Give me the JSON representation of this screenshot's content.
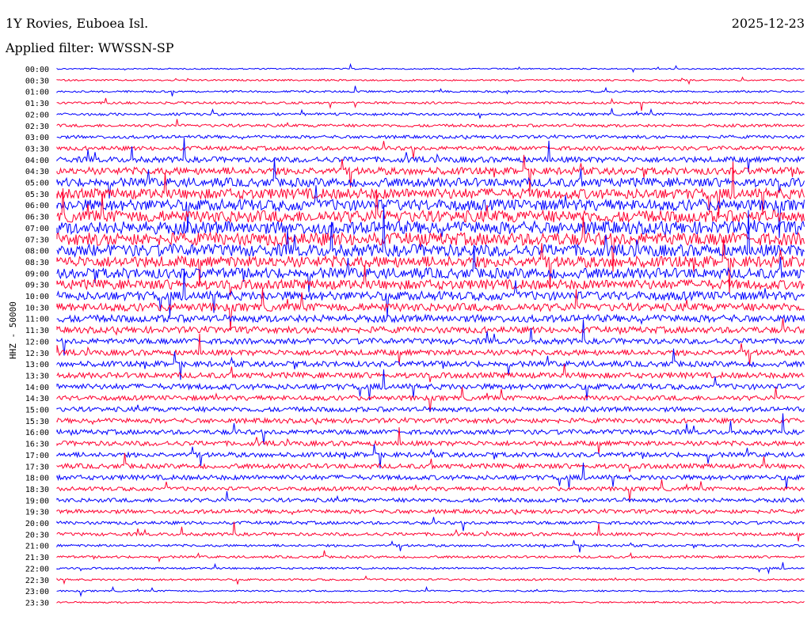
{
  "header": {
    "title": "1Y Rovies, Euboea Isl.",
    "filter": "Applied filter: WWSSN-SP",
    "date": "2025-12-23"
  },
  "chart_data": {
    "type": "line",
    "chart_kind": "helicorder",
    "ylabel": "HHZ - 50000",
    "time_labels": [
      "00:00",
      "00:30",
      "01:00",
      "01:30",
      "02:00",
      "02:30",
      "03:00",
      "03:30",
      "04:00",
      "04:30",
      "05:00",
      "05:30",
      "06:00",
      "06:30",
      "07:00",
      "07:30",
      "08:00",
      "08:30",
      "09:00",
      "09:30",
      "10:00",
      "10:30",
      "11:00",
      "11:30",
      "12:00",
      "12:30",
      "13:00",
      "13:30",
      "14:00",
      "14:30",
      "15:00",
      "15:30",
      "16:00",
      "16:30",
      "17:00",
      "17:30",
      "18:00",
      "18:30",
      "19:00",
      "19:30",
      "20:00",
      "20:30",
      "21:00",
      "21:30",
      "22:00",
      "22:30",
      "23:00",
      "23:30"
    ],
    "trace_amplitude": [
      0.8,
      1.0,
      1.2,
      1.4,
      1.6,
      1.8,
      2.0,
      2.5,
      3.5,
      4.5,
      5.5,
      6.5,
      7.0,
      7.5,
      8.0,
      8.0,
      7.5,
      7.0,
      6.5,
      6.0,
      5.5,
      5.0,
      4.5,
      4.0,
      3.5,
      3.5,
      3.5,
      3.5,
      3.5,
      3.0,
      3.0,
      3.0,
      3.0,
      3.0,
      3.0,
      3.0,
      3.0,
      2.5,
      2.5,
      2.5,
      2.0,
      2.0,
      1.5,
      1.5,
      1.2,
      1.2,
      1.0,
      1.0
    ],
    "colors": [
      "#0000ff",
      "#ff0030"
    ],
    "grid": false,
    "legend": "none"
  }
}
